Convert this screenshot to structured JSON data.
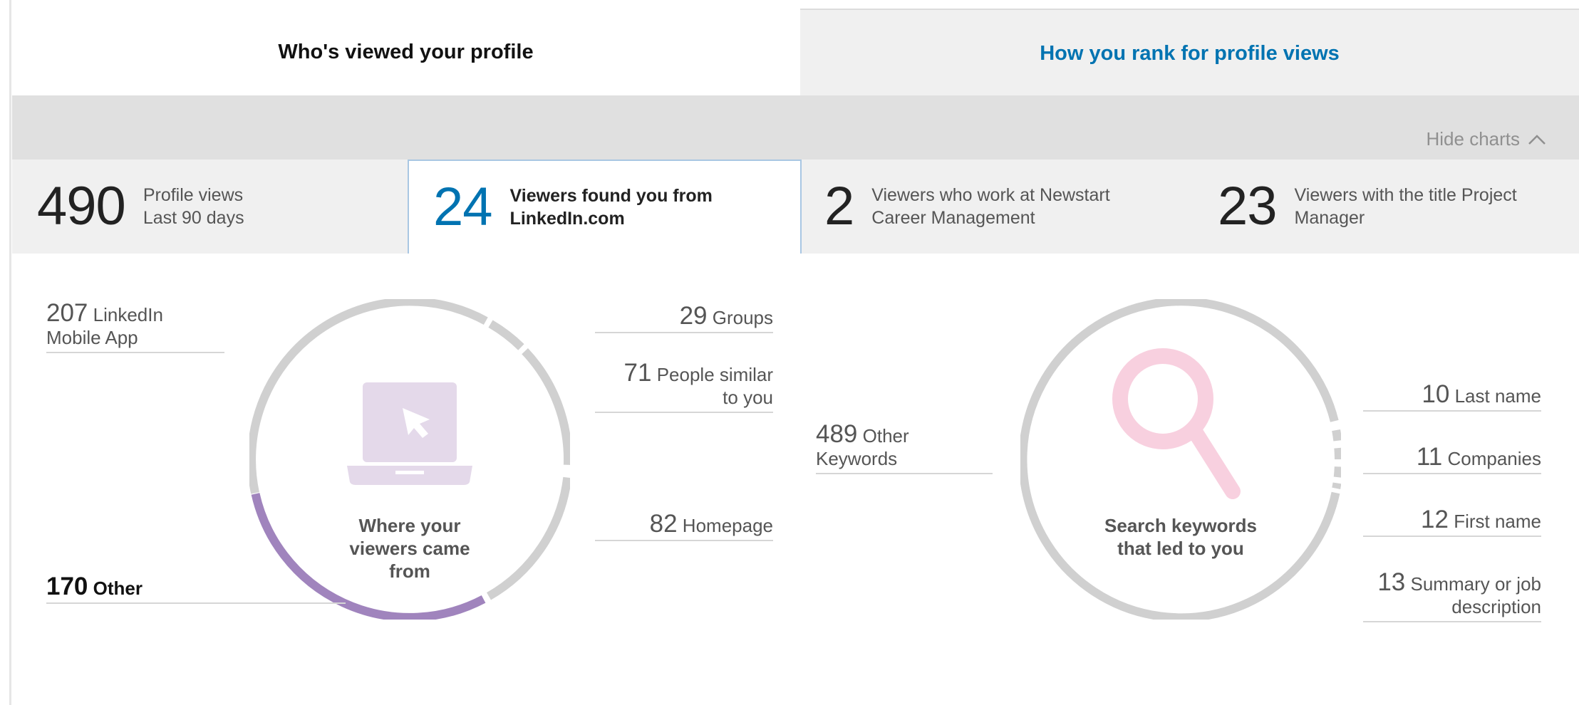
{
  "tabs": [
    {
      "label": "Who's viewed your profile",
      "active": true
    },
    {
      "label": "How you rank for profile views",
      "active": false
    }
  ],
  "hide_charts": {
    "label": "Hide charts",
    "icon": "chevron-up-icon"
  },
  "stats": [
    {
      "value": "490",
      "line1": "Profile views",
      "line2": "Last 90 days",
      "selected": false
    },
    {
      "value": "24",
      "line1": "Viewers found you from",
      "line2": "LinkedIn.com",
      "selected": true
    },
    {
      "value": "2",
      "line1": "Viewers who work at Newstart",
      "line2": "Career Management",
      "selected": false
    },
    {
      "value": "23",
      "line1": "Viewers with the title Project",
      "line2": "Manager",
      "selected": false
    }
  ],
  "colors": {
    "accent": "#0073b1",
    "ring": "#d0d0d0",
    "purple": "#a084bd",
    "laptop": "#e4d9ea",
    "magnifier": "#f8d0df"
  },
  "sources_chart": {
    "center_label_lines": [
      "Where your",
      "viewers came",
      "from"
    ],
    "icon": "laptop-cursor-icon",
    "items": [
      {
        "value": "207",
        "label_line1": "LinkedIn",
        "label_line2": "Mobile App"
      },
      {
        "value": "170",
        "label_line1": "Other",
        "label_line2": "",
        "highlighted": true
      },
      {
        "value": "29",
        "label_line1": "Groups",
        "label_line2": ""
      },
      {
        "value": "71",
        "label_line1": "People similar",
        "label_line2": "to you"
      },
      {
        "value": "82",
        "label_line1": "Homepage",
        "label_line2": ""
      }
    ]
  },
  "keywords_chart": {
    "center_label_lines": [
      "Search keywords",
      "that led to you"
    ],
    "icon": "magnifier-icon",
    "items": [
      {
        "value": "489",
        "label_line1": "Other",
        "label_line2": "Keywords"
      },
      {
        "value": "10",
        "label_line1": "Last name",
        "label_line2": ""
      },
      {
        "value": "11",
        "label_line1": "Companies",
        "label_line2": ""
      },
      {
        "value": "12",
        "label_line1": "First name",
        "label_line2": ""
      },
      {
        "value": "13",
        "label_line1": "Summary or job",
        "label_line2": "description"
      }
    ]
  }
}
